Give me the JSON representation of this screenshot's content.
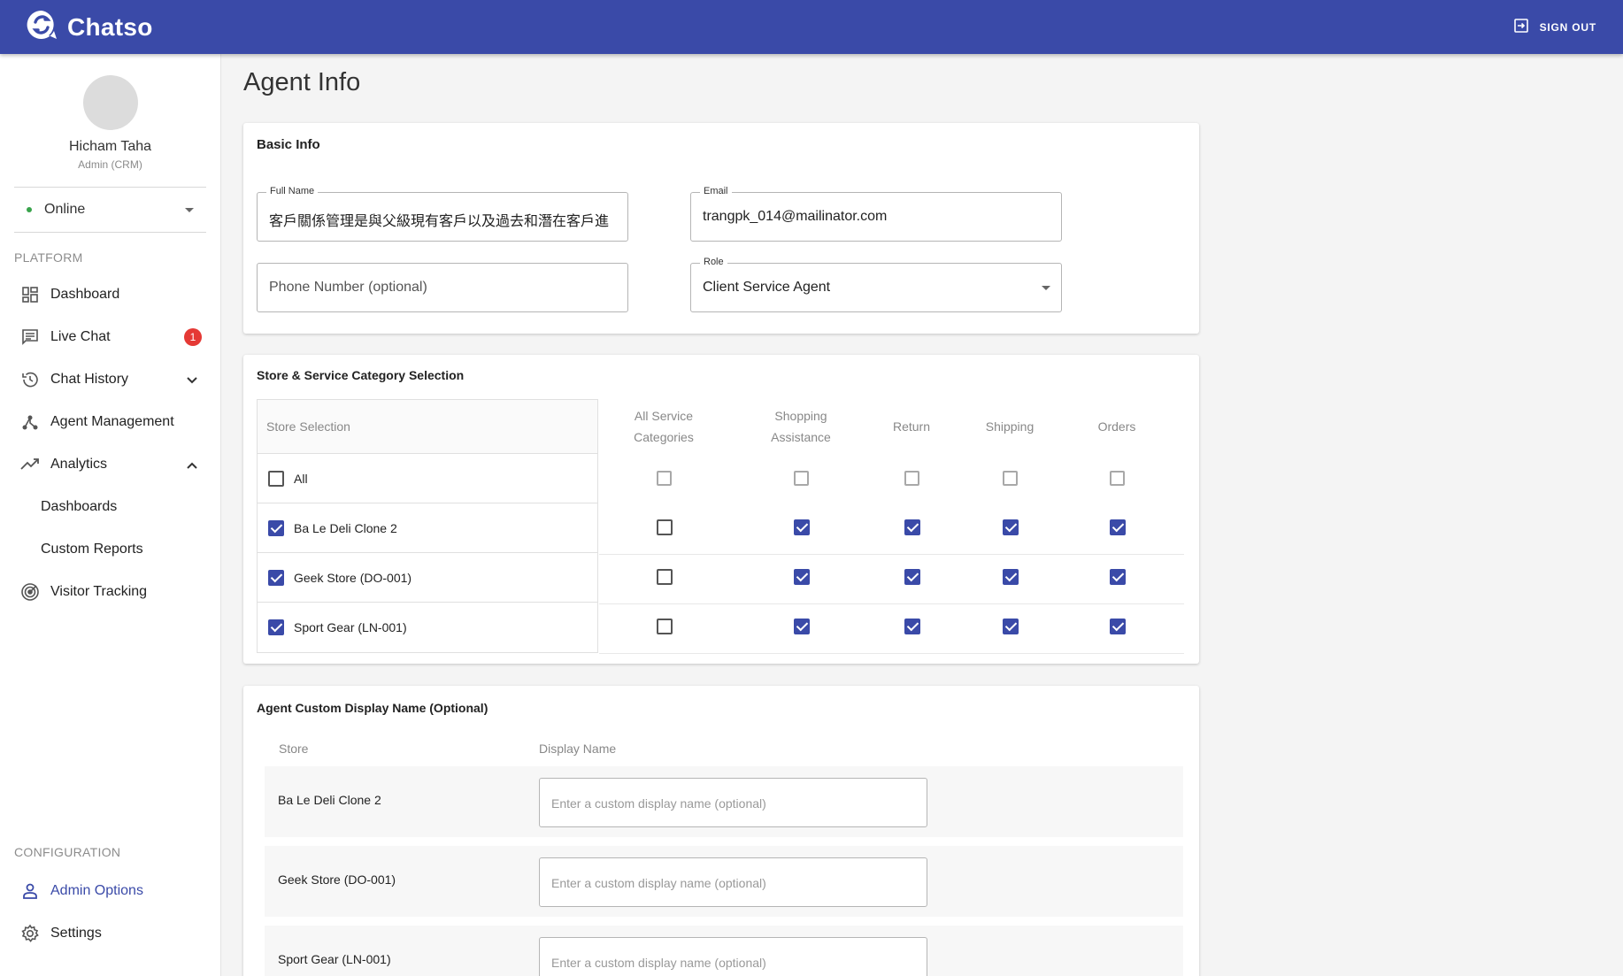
{
  "app": {
    "name": "Chatso"
  },
  "topbar": {
    "sign_out_label": "SIGN OUT"
  },
  "sidebar": {
    "user": {
      "name": "Hicham Taha",
      "role": "Admin (CRM)"
    },
    "status": "Online",
    "platform_label": "PLATFORM",
    "items": [
      {
        "label": "Dashboard"
      },
      {
        "label": "Live Chat",
        "badge": "1"
      },
      {
        "label": "Chat History"
      },
      {
        "label": "Agent Management"
      },
      {
        "label": "Analytics"
      },
      {
        "label": "Dashboards"
      },
      {
        "label": "Custom Reports"
      },
      {
        "label": "Visitor Tracking"
      }
    ],
    "configuration_label": "CONFIGURATION",
    "config_items": [
      {
        "label": "Admin Options"
      },
      {
        "label": "Settings"
      }
    ]
  },
  "page": {
    "title": "Agent Info"
  },
  "basic_info": {
    "title": "Basic Info",
    "full_name": {
      "label": "Full Name",
      "value": "客戶關係管理是與父級現有客戶以及過去和潛在客戶進"
    },
    "email": {
      "label": "Email",
      "value": "trangpk_014@mailinator.com"
    },
    "phone": {
      "placeholder": "Phone Number (optional)"
    },
    "role": {
      "label": "Role",
      "value": "Client Service Agent"
    }
  },
  "store_selection": {
    "title": "Store & Service Category Selection",
    "store_header": "Store Selection",
    "category_headers": [
      {
        "line1": "All Service",
        "line2": "Categories"
      },
      {
        "line1": "Shopping",
        "line2": "Assistance"
      },
      {
        "line1": "Return",
        "line2": ""
      },
      {
        "line1": "Shipping",
        "line2": ""
      },
      {
        "line1": "Orders",
        "line2": ""
      }
    ],
    "rows": [
      {
        "store": "All",
        "selected": false,
        "categories": [
          false,
          false,
          false,
          false,
          false
        ]
      },
      {
        "store": "Ba Le Deli Clone 2",
        "selected": true,
        "categories": [
          false,
          true,
          true,
          true,
          true
        ]
      },
      {
        "store": "Geek Store (DO-001)",
        "selected": true,
        "categories": [
          false,
          true,
          true,
          true,
          true
        ]
      },
      {
        "store": "Sport Gear (LN-001)",
        "selected": true,
        "categories": [
          false,
          true,
          true,
          true,
          true
        ]
      }
    ]
  },
  "display_names": {
    "title": "Agent Custom Display Name (Optional)",
    "store_header": "Store",
    "name_header": "Display Name",
    "placeholder": "Enter a custom display name (optional)",
    "rows": [
      {
        "store": "Ba Le Deli Clone 2"
      },
      {
        "store": "Geek Store (DO-001)"
      },
      {
        "store": "Sport Gear (LN-001)"
      }
    ]
  },
  "colors": {
    "primary": "#3a4aa8",
    "badge": "#e53935",
    "online": "#38a34b"
  }
}
